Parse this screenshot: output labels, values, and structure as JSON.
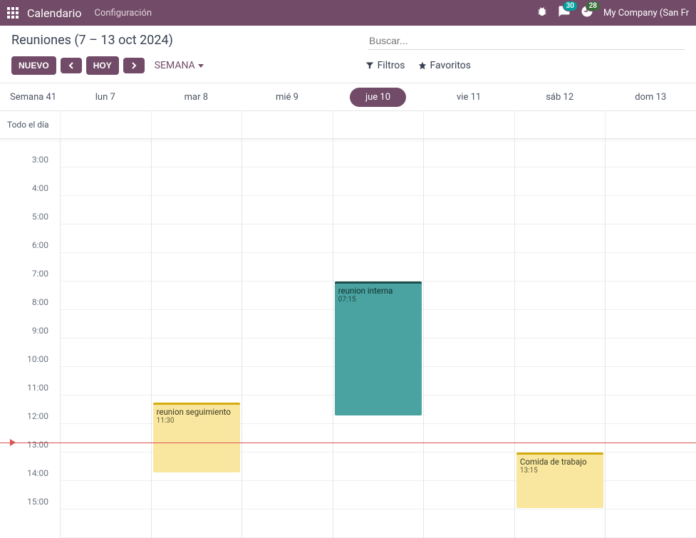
{
  "topbar": {
    "app_name": "Calendario",
    "menu_config": "Configuración",
    "chat_count": "30",
    "activity_count": "28",
    "company": "My Company (San Fr"
  },
  "header": {
    "title": "Reuniones (7 – 13 oct 2024)",
    "search_placeholder": "Buscar..."
  },
  "toolbar": {
    "new_btn": "NUEVO",
    "today_btn": "HOY",
    "scale_label": "SEMANA",
    "filters": "Filtros",
    "favorites": "Favoritos"
  },
  "week": {
    "label": "Semana 41",
    "allday": "Todo el día",
    "days": [
      {
        "label": "lun 7",
        "today": false
      },
      {
        "label": "mar 8",
        "today": false
      },
      {
        "label": "mié 9",
        "today": false
      },
      {
        "label": "jue 10",
        "today": true
      },
      {
        "label": "vie 11",
        "today": false
      },
      {
        "label": "sáb 12",
        "today": false
      },
      {
        "label": "dom 13",
        "today": false
      }
    ],
    "hours": [
      "3:00",
      "4:00",
      "5:00",
      "6:00",
      "7:00",
      "8:00",
      "9:00",
      "10:00",
      "11:00",
      "12:00",
      "13:00",
      "14:00",
      "15:00"
    ],
    "first_hour": 2,
    "now_hour": 12.9
  },
  "events": [
    {
      "title": "reunion seguimiento",
      "time": "11:30",
      "day": 1,
      "start": 11.5,
      "end": 14.0,
      "palette": "yellow"
    },
    {
      "title": "reunion interna",
      "time": "07:15",
      "day": 3,
      "start": 7.25,
      "end": 12.0,
      "palette": "teal"
    },
    {
      "title": "Comida de trabajo",
      "time": "13:15",
      "day": 5,
      "start": 13.25,
      "end": 15.25,
      "palette": "yellow"
    }
  ]
}
